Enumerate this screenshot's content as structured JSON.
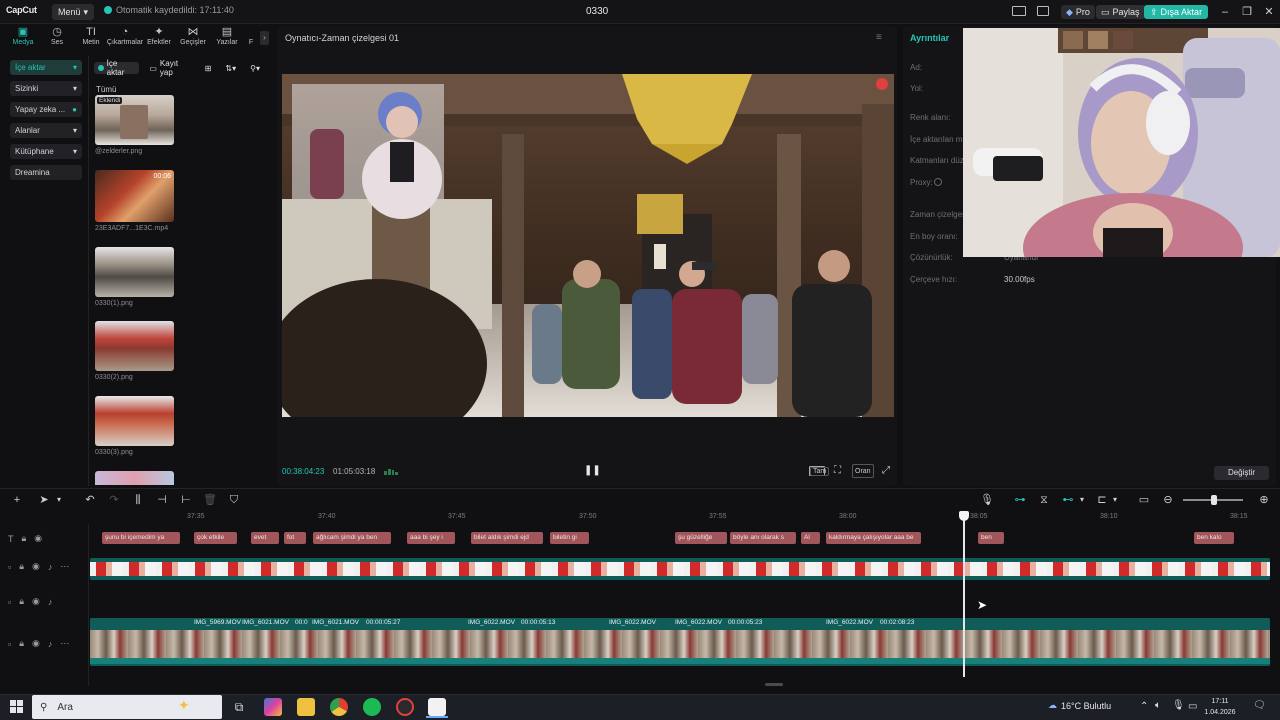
{
  "app": {
    "logo": "CapCut",
    "menu_label": "Menü",
    "autosave": "Otomatik kaydedildi: 17:11:40",
    "project_name": "0330",
    "pro_label": "Pro",
    "share_label": "Paylaş",
    "export_label": "Dışa Aktar",
    "accent": "#27c4b4"
  },
  "tool_tabs": [
    {
      "label": "Medya",
      "icon": "media-icon"
    },
    {
      "label": "Ses",
      "icon": "audio-icon"
    },
    {
      "label": "Metin",
      "icon": "text-icon"
    },
    {
      "label": "Çıkartmalar",
      "icon": "sticker-icon"
    },
    {
      "label": "Efektler",
      "icon": "effects-icon"
    },
    {
      "label": "Geçişler",
      "icon": "transitions-icon"
    },
    {
      "label": "Yazılar",
      "icon": "captions-icon"
    },
    {
      "label": "F",
      "icon": "filters-icon"
    }
  ],
  "left_nav": [
    {
      "label": "İçe aktar"
    },
    {
      "label": "Sizinki"
    },
    {
      "label": "Yapay zeka ..."
    },
    {
      "label": "Alanlar"
    },
    {
      "label": "Kütüphane"
    },
    {
      "label": "Dreamina"
    }
  ],
  "media": {
    "import_label": "İçe aktar",
    "record_label": "Kayıt yap",
    "all_label": "Tümü",
    "items": [
      {
        "name": "@zelderler.png",
        "badge": "Eklendi",
        "duration": ""
      },
      {
        "name": "23E3ADF7...1E3C.mp4",
        "badge": "",
        "duration": "00:06"
      },
      {
        "name": "0330(1).png",
        "badge": "",
        "duration": ""
      },
      {
        "name": "0330(2).png",
        "badge": "",
        "duration": ""
      },
      {
        "name": "0330(3).png",
        "badge": "",
        "duration": ""
      }
    ]
  },
  "player": {
    "title": "Oynatıcı-Zaman çizelgesi 01",
    "current_time": "00:38:04:23",
    "total_time": "01:05:03:18",
    "full_label": "Tam",
    "ratio_label": "Oran"
  },
  "details": {
    "title": "Ayrıntılar",
    "fields": [
      {
        "label": "Ad:",
        "value": ""
      },
      {
        "label": "Yol:",
        "value": ""
      },
      {
        "label": "Renk alanı:",
        "value": ""
      },
      {
        "label": "İçe aktarılan me",
        "value": ""
      },
      {
        "label": "Katmanları düz",
        "value": ""
      },
      {
        "label": "Proxy:",
        "value": ""
      },
      {
        "label": "Zaman çizelges",
        "value": ""
      },
      {
        "label": "En boy oranı:",
        "value": ""
      },
      {
        "label": "Çözünürlük:",
        "value": "Uyarlandı"
      },
      {
        "label": "Çerçeve hızı:",
        "value": "30.00fps"
      }
    ],
    "change_label": "Değiştir"
  },
  "timeline": {
    "ticks": [
      "37:35",
      "37:40",
      "37:45",
      "37:50",
      "37:55",
      "38:00",
      "38:05",
      "38:10",
      "38:15"
    ],
    "text_clips": [
      "şunu bi içemedim ya",
      "çok etkile",
      "evet",
      "fot",
      "ağlıcam şimdi ya ben",
      "aaa bi şey i",
      "bilet aldık şimdi ejd",
      "biletin gi",
      "şu güzelliğe",
      "böyle anı olarak s",
      "Al",
      "kaldırmaya çalışıyolar aaa be",
      "ben",
      "ben kalo"
    ],
    "video_labels": [
      "IMG_5969.MOV",
      "IMG_6021.MOV",
      "00:0",
      "IMG_6021.MOV",
      "00:00:05:27",
      "IMG_6022.MOV",
      "00:00:05:13",
      "IMG_6022.MOV",
      "IMG_6022.MOV",
      "00:00:05:23",
      "IMG_6022.MOV",
      "00:02:08:23"
    ]
  },
  "taskbar": {
    "search_placeholder": "Ara",
    "weather": "16°C  Bulutlu",
    "time": "17:11",
    "date": "1.04.2026"
  }
}
